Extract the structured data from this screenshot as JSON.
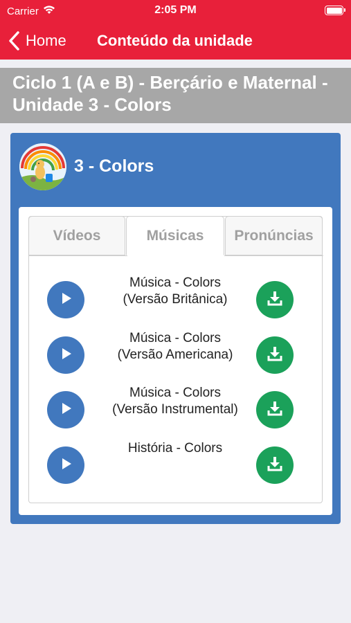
{
  "status_bar": {
    "carrier": "Carrier",
    "time": "2:05 PM"
  },
  "nav": {
    "back_label": "Home",
    "title": "Conteúdo da unidade"
  },
  "header": {
    "line1": "Ciclo 1 (A e B) - Berçário e Maternal -",
    "line2": "Unidade 3 - Colors"
  },
  "unit": {
    "title": "3 - Colors"
  },
  "tabs": [
    {
      "label": "Vídeos"
    },
    {
      "label": "Músicas"
    },
    {
      "label": "Pronúncias"
    }
  ],
  "tracks": [
    {
      "line1": "Música - Colors",
      "line2": "(Versão Britânica)"
    },
    {
      "line1": "Música - Colors",
      "line2": "(Versão Americana)"
    },
    {
      "line1": "Música - Colors",
      "line2": "(Versão Instrumental)"
    },
    {
      "line1": "História - Colors",
      "line2": ""
    }
  ],
  "colors": {
    "brand_red": "#e8203a",
    "card_blue": "#4178be",
    "download_green": "#1ba15a",
    "header_gray": "#a7a7a7"
  }
}
